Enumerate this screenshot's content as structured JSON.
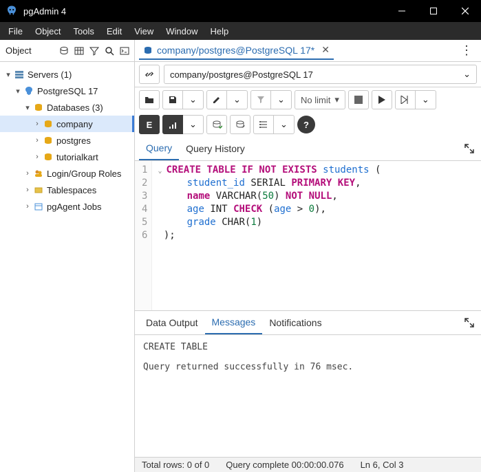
{
  "window": {
    "title": "pgAdmin 4"
  },
  "menus": [
    "File",
    "Object",
    "Tools",
    "Edit",
    "View",
    "Window",
    "Help"
  ],
  "side_tab_label": "Object",
  "tree": {
    "servers": "Servers (1)",
    "pg": "PostgreSQL 17",
    "databases": "Databases (3)",
    "db1": "company",
    "db2": "postgres",
    "db3": "tutorialkart",
    "login": "Login/Group Roles",
    "tablespaces": "Tablespaces",
    "pgagent": "pgAgent Jobs"
  },
  "editor_tab": "company/postgres@PostgreSQL 17*",
  "conn_label": "company/postgres@PostgreSQL 17",
  "limit_label": "No limit",
  "query_tabs": {
    "query": "Query",
    "history": "Query History"
  },
  "sql": {
    "l1a": "CREATE",
    "l1b": "TABLE",
    "l1c": "IF",
    "l1d": "NOT",
    "l1e": "EXISTS",
    "l1f": "students",
    "l2a": "student_id",
    "l2b": "SERIAL",
    "l2c": "PRIMARY",
    "l2d": "KEY",
    "l3a": "name",
    "l3b": "VARCHAR",
    "l3c": "50",
    "l3d": "NOT",
    "l3e": "NULL",
    "l4a": "age",
    "l4b": "INT",
    "l4c": "CHECK",
    "l4d": "age",
    "l4e": "0",
    "l5a": "grade",
    "l5b": "CHAR",
    "l5c": "1"
  },
  "lines": [
    "1",
    "2",
    "3",
    "4",
    "5",
    "6"
  ],
  "output_tabs": {
    "data": "Data Output",
    "messages": "Messages",
    "notifications": "Notifications"
  },
  "messages": {
    "line1": "CREATE TABLE",
    "line2": "Query returned successfully in 76 msec."
  },
  "status": {
    "rows": "Total rows: 0 of 0",
    "complete": "Query complete 00:00:00.076",
    "pos": "Ln 6, Col 3"
  }
}
